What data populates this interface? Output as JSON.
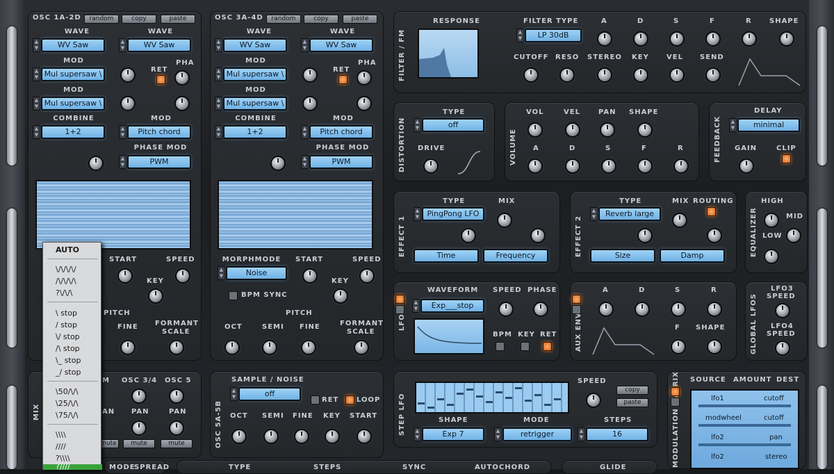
{
  "osc1": {
    "title": "OSC 1A-2D",
    "random": "random",
    "copy": "copy",
    "paste": "paste",
    "wave": "WAVE",
    "wave2": "WAVE",
    "wave_val": "WV Saw",
    "wave2_val": "WV Saw",
    "mod": "MOD",
    "mod2": "MOD",
    "mod_val": "Mul supersaw \\",
    "mod2_val": "Mul supersaw \\",
    "ret": "RET",
    "pha": "PHA",
    "combine": "COMBINE",
    "combine_val": "1+2",
    "mod3": "MOD",
    "mod3_val": "Pitch chord",
    "phase_mod": "PHASE MOD",
    "phase_mod_val": "PWM",
    "start": "START",
    "speed": "SPEED",
    "key": "KEY",
    "pitch": "PITCH",
    "fine": "FINE",
    "formant": "FORMANT",
    "scale": "SCALE"
  },
  "osc3": {
    "title": "OSC 3A-4D",
    "random": "random",
    "copy": "copy",
    "paste": "paste",
    "wave": "WAVE",
    "wave2": "WAVE",
    "wave_val": "WV Saw",
    "wave2_val": "WV Saw",
    "mod": "MOD",
    "mod2": "MOD",
    "mod_val": "Mul supersaw \\",
    "mod2_val": "Mul supersaw \\",
    "ret": "RET",
    "pha": "PHA",
    "combine": "COMBINE",
    "combine_val": "1+2",
    "mod3": "MOD",
    "mod3_val": "Pitch chord",
    "phase_mod": "PHASE MOD",
    "phase_mod_val": "PWM",
    "morphmode": "MORPHMODE",
    "morphmode_val": "Noise",
    "start": "START",
    "speed": "SPEED",
    "bpm_sync": "BPM SYNC",
    "key": "KEY",
    "pitch": "PITCH",
    "oct": "OCT",
    "semi": "SEMI",
    "fine": "FINE",
    "formant": "FORMANT",
    "scale": "SCALE"
  },
  "menu": {
    "items": [
      "AUTO",
      "\\/\\/\\/\\/",
      "/\\/\\/\\/\\",
      "?\\/\\/\\",
      "\\ stop",
      "/ stop",
      "\\/ stop",
      "/\\ stop",
      "\\_ stop",
      "_/ stop",
      "\\50/\\/\\",
      "\\25/\\/\\",
      "\\75/\\/\\",
      "\\\\\\\\",
      "////",
      "?\\\\\\\\",
      "?////"
    ]
  },
  "mix": {
    "title": "MIX",
    "osc34": "OSC 3/4",
    "osc5": "OSC 5",
    "pan": "PAN",
    "pan2": "PAN",
    "mute": "mute",
    "mute2": "mute",
    "mute3": "mute",
    "m": "M",
    "an": "AN"
  },
  "sample": {
    "vlabel": "OSC 5A-5B",
    "title": "SAMPLE / NOISE",
    "val": "off",
    "ret": "RET",
    "loop": "LOOP",
    "oct": "OCT",
    "semi": "SEMI",
    "fine": "FINE",
    "key": "KEY",
    "start": "START"
  },
  "filter": {
    "vlabel": "FILTER / FM",
    "response": "RESPONSE",
    "type": "FILTER TYPE",
    "type_val": "LP 30dB",
    "cutoff": "CUTOFF",
    "reso": "RESO",
    "stereo": "STEREO",
    "key": "KEY",
    "vel": "VEL",
    "send": "SEND",
    "a": "A",
    "d": "D",
    "s": "S",
    "f": "F",
    "r": "R",
    "shape": "SHAPE"
  },
  "distortion": {
    "vlabel": "DISTORTION",
    "type": "TYPE",
    "type_val": "off",
    "drive": "DRIVE"
  },
  "volume": {
    "vlabel": "VOLUME",
    "vol": "VOL",
    "vel": "VEL",
    "pan": "PAN",
    "shape": "SHAPE",
    "a": "A",
    "d": "D",
    "s": "S",
    "f": "F",
    "r": "R"
  },
  "delay": {
    "vlabel": "FEEDBACK",
    "title": "DELAY",
    "val": "minimal",
    "gain": "GAIN",
    "clip": "CLIP"
  },
  "effect1": {
    "vlabel": "EFFECT 1",
    "type": "TYPE",
    "type_val": "PingPong LFO",
    "mix": "MIX",
    "time": "Time",
    "freq": "Frequency"
  },
  "effect2": {
    "vlabel": "EFFECT 2",
    "type": "TYPE",
    "type_val": "Reverb large",
    "mix": "MIX",
    "routing": "ROUTING",
    "size": "Size",
    "damp": "Damp"
  },
  "eq": {
    "vlabel": "EQUALIZER",
    "high": "HIGH",
    "mid": "MID",
    "low": "LOW"
  },
  "lfo": {
    "vlabel": "LFO",
    "waveform": "WAVEFORM",
    "waveform_val": "Exp___stop",
    "speed": "SPEED",
    "phase": "PHASE",
    "bpm": "BPM",
    "key": "KEY",
    "ret": "RET"
  },
  "auxenv": {
    "vlabel": "AUX ENV",
    "a": "A",
    "d": "D",
    "s": "S",
    "r": "R",
    "f": "F",
    "shape": "SHAPE"
  },
  "global_lfo": {
    "vlabel": "GLOBAL LFOS",
    "lfo3": "LFO3",
    "speed": "SPEED",
    "lfo4": "LFO4",
    "speed2": "SPEED"
  },
  "steplfo": {
    "vlabel": "STEP LFO",
    "speed": "SPEED",
    "copy": "copy",
    "paste": "paste",
    "shape": "SHAPE",
    "shape_val": "Exp 7",
    "mode": "MODE",
    "mode_val": "retrigger",
    "steps": "STEPS",
    "steps_val": "16"
  },
  "matrix": {
    "vlabel": "MODULATION MATRIX",
    "source": "SOURCE",
    "amount": "AMOUNT",
    "dest": "DEST",
    "rows": [
      {
        "src": "lfo1",
        "dst": "cutoff"
      },
      {
        "src": "modwheel",
        "dst": "cutoff"
      },
      {
        "src": "lfo2",
        "dst": "pan"
      },
      {
        "src": "lfo2",
        "dst": "stereo"
      }
    ]
  },
  "bottom": {
    "type": "TYPE",
    "steps": "STEPS",
    "sync": "SYNC",
    "autochord": "AUTOCHORD",
    "glide": "GLIDE",
    "mode": "MODE",
    "spread": "SPREAD"
  },
  "colors": {
    "accent": "#7db9ea",
    "led": "#e0782c"
  }
}
